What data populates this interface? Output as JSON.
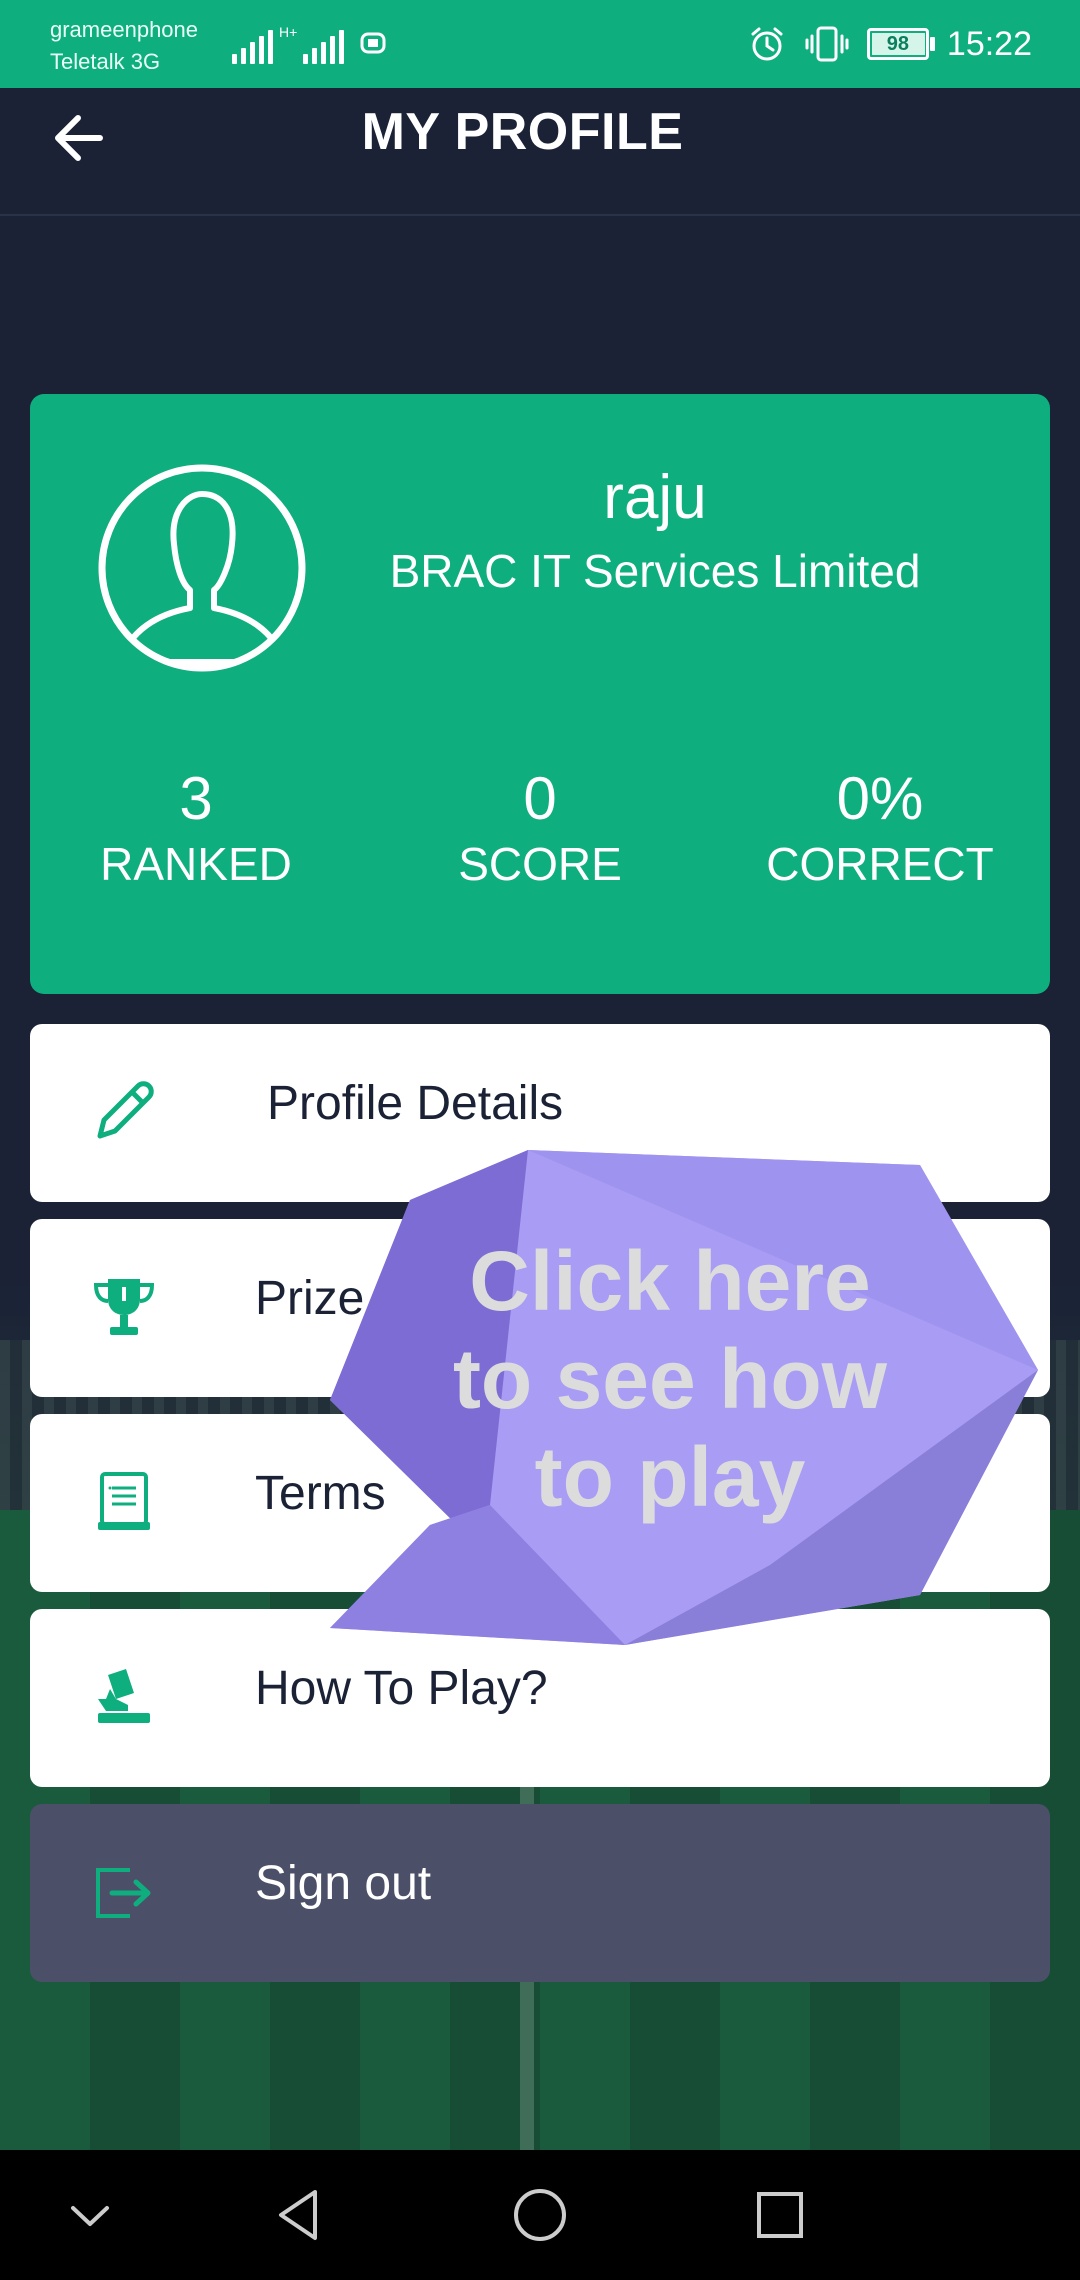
{
  "status_bar": {
    "carrier_1": "grameenphone",
    "carrier_2": "Teletalk 3G",
    "network_tag": "H+",
    "battery_level": "98",
    "time": "15:22",
    "icons": [
      "signal-icon",
      "alarm-icon",
      "vibrate-icon",
      "battery-icon"
    ]
  },
  "header": {
    "title": "MY PROFILE",
    "back_icon": "back-arrow-icon"
  },
  "profile": {
    "name": "raju",
    "company": "BRAC IT Services Limited",
    "avatar_icon": "user-avatar-icon",
    "stats": [
      {
        "value": "3",
        "label": "RANKED"
      },
      {
        "value": "0",
        "label": "SCORE"
      },
      {
        "value": "0%",
        "label": "CORRECT"
      }
    ]
  },
  "menu": {
    "items": [
      {
        "label": "Profile Details",
        "icon": "pencil-icon"
      },
      {
        "label": "Prize l",
        "icon": "trophy-icon"
      },
      {
        "label": "Terms",
        "icon": "document-icon"
      },
      {
        "label": "How To Play?",
        "icon": "hand-card-icon"
      }
    ],
    "signout": {
      "label": "Sign out",
      "icon": "sign-out-icon"
    }
  },
  "tooltip": {
    "lines": [
      "Click here",
      "to see how",
      "to play"
    ]
  },
  "colors": {
    "accent": "#0fae7f",
    "background": "#1b2236",
    "signout": "#4b5068",
    "bubble": "#a99cf5"
  }
}
